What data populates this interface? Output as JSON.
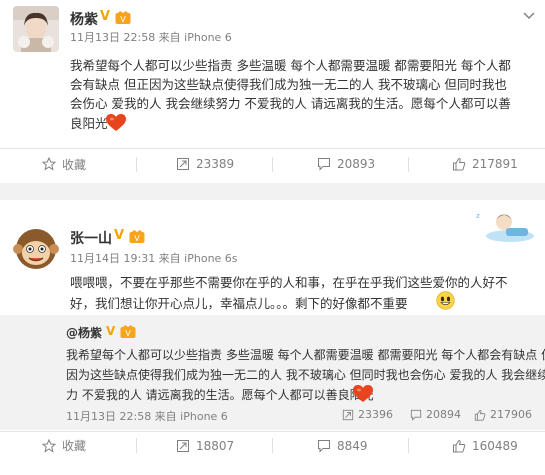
{
  "post1": {
    "username": "杨紫",
    "verified_mark": "V",
    "meta": "11月13日 22:58 来自 iPhone 6",
    "text_lines": [
      "我希望每个人都可以少些指责 多些温暖 每个人都需要温暖 都需要阳光 每个人都",
      "会有缺点 但正因为这些缺点使得我们成为独一无二的人 我不玻璃心 但同时我也",
      "会伤心 爱我的人 我会继续努力 不爱我的人 请远离我的生活。愿每个人都可以善",
      "良阳光"
    ],
    "actions": {
      "favorite": "收藏",
      "repost": "23389",
      "comment": "20893",
      "like": "217891"
    }
  },
  "post2": {
    "username": "张一山",
    "verified_mark": "V",
    "meta": "11月14日 19:31 来自 iPhone 6s",
    "text_lines": [
      "喂喂喂，不要在乎那些不需要你在乎的人和事，在乎在乎我们这些爱你的人好不",
      "好，我们想让你开心点儿，幸福点儿。。。剩下的好像都不重要"
    ],
    "quote": {
      "mention": "@杨紫",
      "verified_mark": "V",
      "text_lines": [
        "我希望每个人都可以少些指责 多些温暖 每个人都需要温暖 都需要阳光 每个人都会有缺点 但正",
        "因为这些缺点使得我们成为独一无二的人 我不玻璃心 但同时我也会伤心 爱我的人 我会继续努",
        "力 不爱我的人 请远离我的生活。愿每个人都可以善良阳光"
      ],
      "meta": "11月13日 22:58 来自 iPhone 6",
      "repost": "23396",
      "comment": "20894",
      "like": "217906"
    },
    "actions": {
      "favorite": "收藏",
      "repost": "18807",
      "comment": "8849",
      "like": "160489"
    }
  },
  "colors": {
    "verified": "#f0a500",
    "heart": "#e8451e",
    "meta_gray": "#808080",
    "quote_bg": "#f2f2f2"
  },
  "icons": [
    "avatar",
    "vip-badge-icon",
    "heart-emoji-icon",
    "star-icon",
    "repost-icon",
    "comment-icon",
    "thumbs-up-icon",
    "chevron-down-icon",
    "grin-emoji-icon"
  ]
}
